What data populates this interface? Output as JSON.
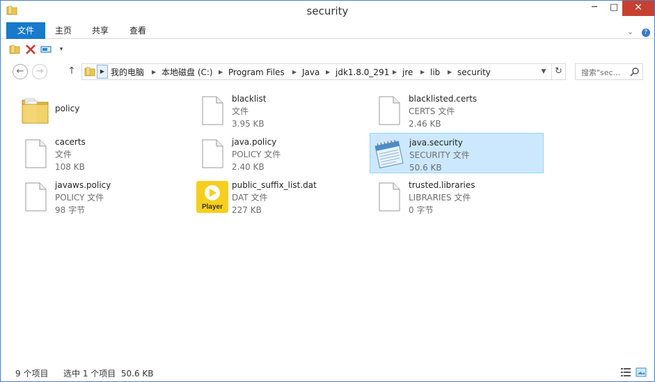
{
  "window": {
    "title": "security"
  },
  "titlebar": {
    "min": "─",
    "max": "□",
    "close": "✕"
  },
  "ribbon": {
    "tabs": [
      {
        "label": "文件"
      },
      {
        "label": "主页"
      },
      {
        "label": "共享"
      },
      {
        "label": "查看"
      }
    ],
    "collapse": "⌄",
    "help": "?"
  },
  "address": {
    "crumbs": [
      "我的电脑",
      "本地磁盘 (C:)",
      "Program Files",
      "Java",
      "jdk1.8.0_291",
      "jre",
      "lib",
      "security"
    ]
  },
  "search": {
    "placeholder": "搜索\"sec..."
  },
  "files": [
    {
      "name": "policy",
      "type": "",
      "size": "",
      "icon": "folder-icon"
    },
    {
      "name": "blacklist",
      "type": "文件",
      "size": "3.95 KB",
      "icon": "file-icon"
    },
    {
      "name": "blacklisted.certs",
      "type": "CERTS 文件",
      "size": "2.46 KB",
      "icon": "file-icon"
    },
    {
      "name": "cacerts",
      "type": "文件",
      "size": "108 KB",
      "icon": "file-icon"
    },
    {
      "name": "java.policy",
      "type": "POLICY 文件",
      "size": "2.40 KB",
      "icon": "file-icon"
    },
    {
      "name": "java.security",
      "type": "SECURITY 文件",
      "size": "50.6 KB",
      "icon": "notepad-icon",
      "selected": true
    },
    {
      "name": "javaws.policy",
      "type": "POLICY 文件",
      "size": "98 字节",
      "icon": "file-icon"
    },
    {
      "name": "public_suffix_list.dat",
      "type": "DAT 文件",
      "size": "227 KB",
      "icon": "player-icon",
      "icon_label": "Player"
    },
    {
      "name": "trusted.libraries",
      "type": "LIBRARIES 文件",
      "size": "0 字节",
      "icon": "file-icon"
    }
  ],
  "status": {
    "count": "9 个项目",
    "selection": "选中 1 个项目  50.6 KB"
  },
  "colors": {
    "accent": "#1979ca",
    "selection_bg": "#cce8ff",
    "selection_border": "#99d1ff",
    "close": "#c7402f"
  }
}
